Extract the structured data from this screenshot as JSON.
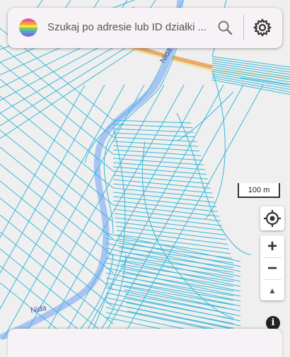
{
  "search": {
    "placeholder": "Szukaj po adresie lub ID działki ..."
  },
  "map": {
    "river_labels": [
      "Nida",
      "Nida"
    ],
    "scale_label": "100 m"
  },
  "colors": {
    "parcel_lines": "#38b8d8",
    "river": "#a9c3f2",
    "road": "#e8a15d",
    "background": "#efefef"
  },
  "controls": {
    "zoom_in": "+",
    "zoom_out": "−",
    "compass": "▲",
    "info": "i"
  },
  "icons": [
    "rainbow-logo-icon",
    "search-icon",
    "gear-icon",
    "locate-icon",
    "compass-icon",
    "info-icon"
  ]
}
